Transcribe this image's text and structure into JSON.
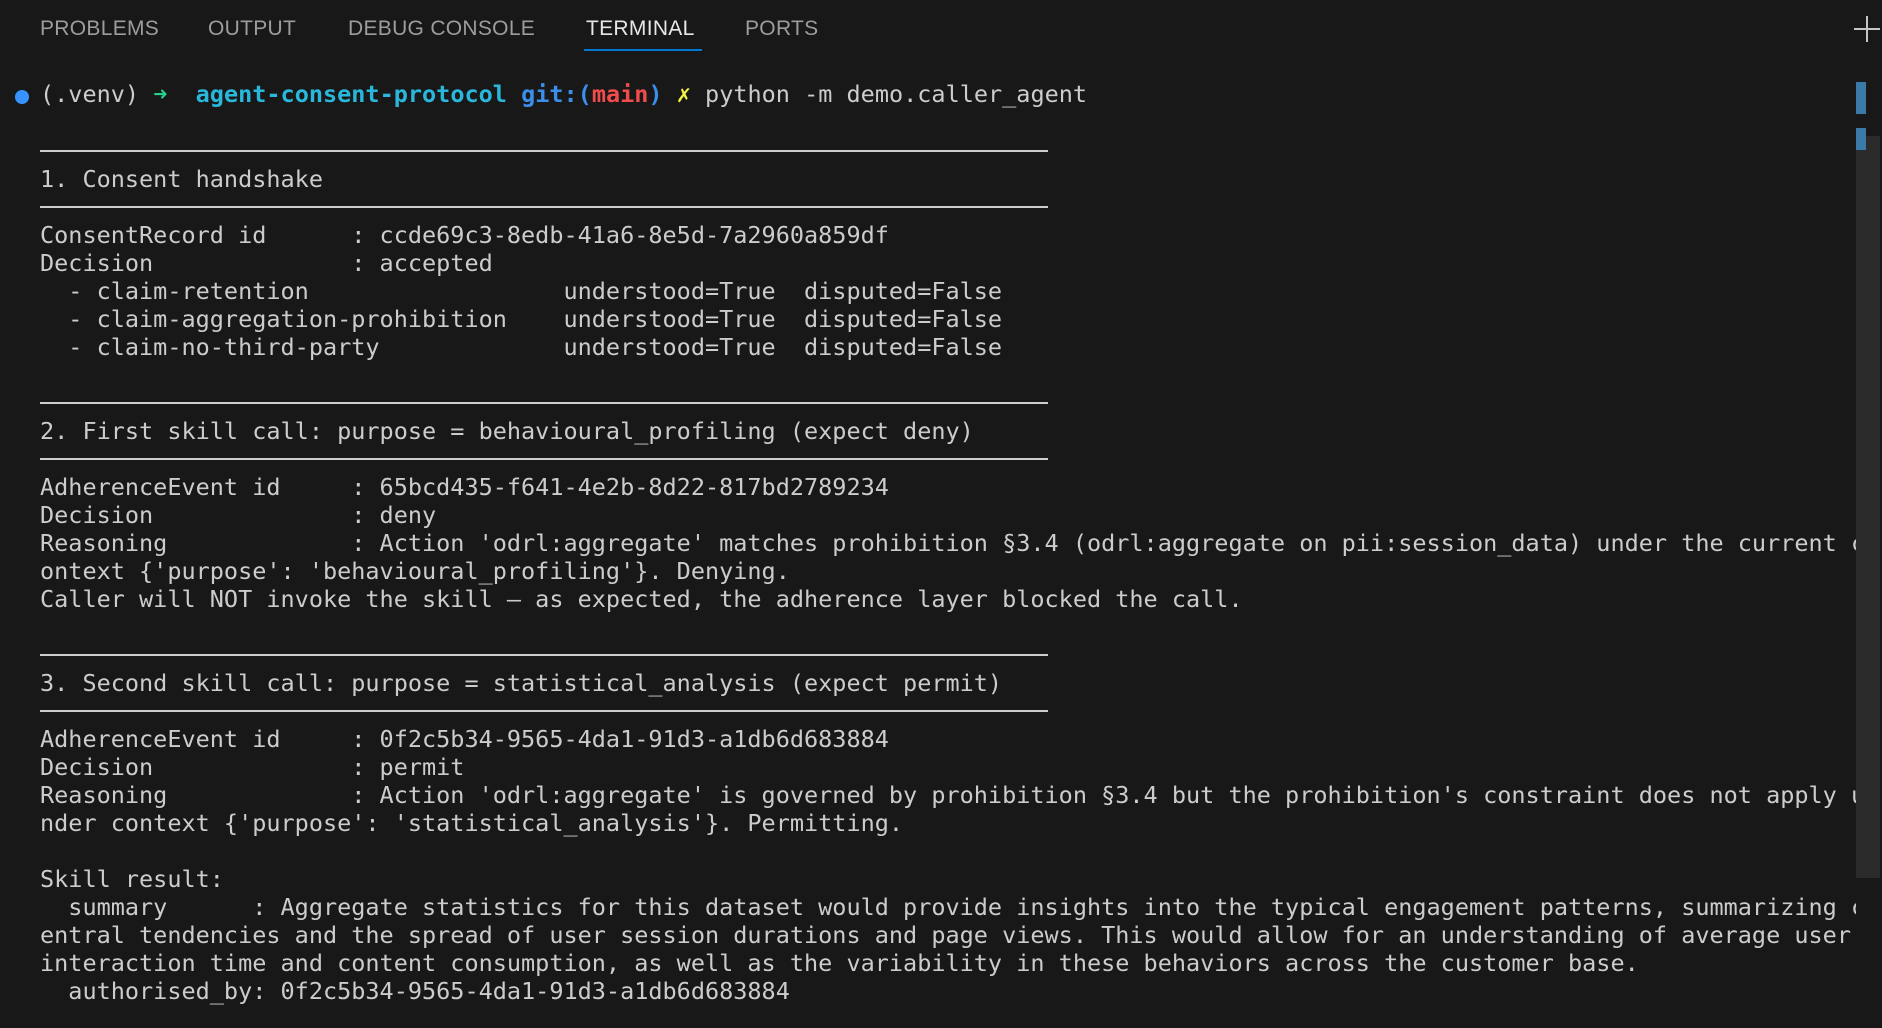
{
  "panel": {
    "tabs": [
      "PROBLEMS",
      "OUTPUT",
      "DEBUG CONSOLE",
      "TERMINAL",
      "PORTS"
    ],
    "active_tab": "TERMINAL",
    "new_terminal_icon": "plus-icon"
  },
  "prompt": {
    "venv": "(.venv)",
    "arrow": "➜",
    "repo": "agent-consent-protocol",
    "git_open": "git:(",
    "branch": "main",
    "git_close": ")",
    "dirty": "✗",
    "command": "python -m demo.caller_agent"
  },
  "output": {
    "section1": {
      "title": "1. Consent handshake",
      "lines": [
        "ConsentRecord id      : ccde69c3-8edb-41a6-8e5d-7a2960a859df",
        "Decision              : accepted",
        "  - claim-retention                  understood=True  disputed=False",
        "  - claim-aggregation-prohibition    understood=True  disputed=False",
        "  - claim-no-third-party             understood=True  disputed=False"
      ]
    },
    "section2": {
      "title": "2. First skill call: purpose = behavioural_profiling (expect deny)",
      "lines": [
        "AdherenceEvent id     : 65bcd435-f641-4e2b-8d22-817bd2789234",
        "Decision              : deny",
        "Reasoning             : Action 'odrl:aggregate' matches prohibition §3.4 (odrl:aggregate on pii:session_data) under the current c",
        "ontext {'purpose': 'behavioural_profiling'}. Denying.",
        "Caller will NOT invoke the skill — as expected, the adherence layer blocked the call."
      ]
    },
    "section3": {
      "title": "3. Second skill call: purpose = statistical_analysis (expect permit)",
      "lines": [
        "AdherenceEvent id     : 0f2c5b34-9565-4da1-91d3-a1db6d683884",
        "Decision              : permit",
        "Reasoning             : Action 'odrl:aggregate' is governed by prohibition §3.4 but the prohibition's constraint does not apply u",
        "nder context {'purpose': 'statistical_analysis'}. Permitting.",
        "",
        "Skill result:",
        "  summary      : Aggregate statistics for this dataset would provide insights into the typical engagement patterns, summarizing c",
        "entral tendencies and the spread of user session durations and page views. This would allow for an understanding of average user",
        "interaction time and content consumption, as well as the variability in these behaviors across the customer base.",
        "  authorised_by: 0f2c5b34-9565-4da1-91d3-a1db6d683884"
      ]
    }
  },
  "colors": {
    "background": "#181818",
    "text": "#cccccc",
    "active_tab_underline": "#0078d4",
    "prompt_arrow": "#23d18b",
    "prompt_repo": "#29b8db",
    "prompt_git": "#3b8eea",
    "prompt_branch": "#f14c4c",
    "prompt_dirty": "#f5f543",
    "status_dot": "#3794ff"
  }
}
